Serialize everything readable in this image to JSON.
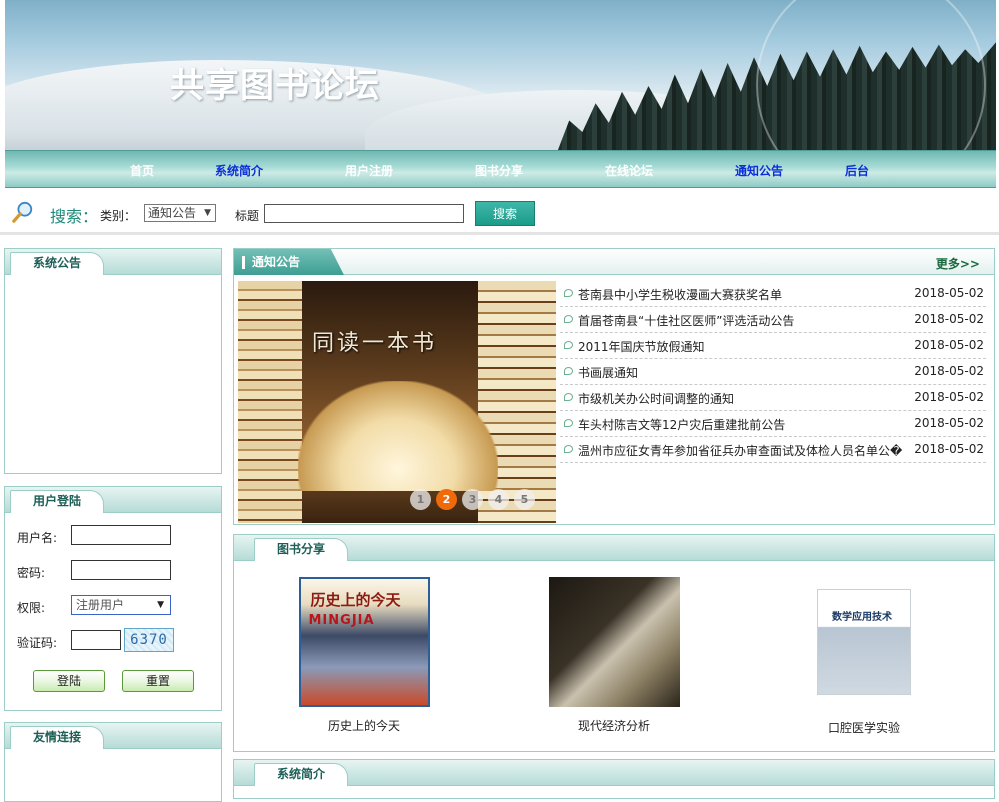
{
  "site": {
    "title": "共享图书论坛"
  },
  "nav": {
    "items": [
      {
        "label": "首页"
      },
      {
        "label": "系统简介"
      },
      {
        "label": "用户注册"
      },
      {
        "label": "图书分享"
      },
      {
        "label": "在线论坛"
      },
      {
        "label": "通知公告"
      },
      {
        "label": "后台"
      }
    ]
  },
  "search": {
    "label": "搜索：",
    "category_label": "类别：",
    "category_value": "通知公告",
    "title_label": "标题",
    "title_value": "",
    "button": "搜索"
  },
  "system_notice": {
    "title": "系统公告"
  },
  "login": {
    "title": "用户登陆",
    "username_label": "用户名:",
    "password_label": "密码:",
    "role_label": "权限:",
    "role_value": "注册用户",
    "captcha_label": "验证码:",
    "captcha_text": "6370",
    "login_button": "登陆",
    "reset_button": "重置"
  },
  "links": {
    "title": "友情连接"
  },
  "notices": {
    "title": "通知公告",
    "more": "更多>>",
    "slider_caption": "同读一本书",
    "slider_pages": [
      "1",
      "2",
      "3",
      "4",
      "5"
    ],
    "active_page": "2",
    "items": [
      {
        "title": "苍南县中小学生税收漫画大赛获奖名单",
        "date": "2018-05-02"
      },
      {
        "title": "首届苍南县“十佳社区医师”评选活动公告",
        "date": "2018-05-02"
      },
      {
        "title": "2011年国庆节放假通知",
        "date": "2018-05-02"
      },
      {
        "title": "书画展通知",
        "date": "2018-05-02"
      },
      {
        "title": "市级机关办公时间调整的通知",
        "date": "2018-05-02"
      },
      {
        "title": "车头村陈吉文等12户灾后重建批前公告",
        "date": "2018-05-02"
      },
      {
        "title": "温州市应征女青年参加省征兵办审查面试及体检人员名单公�",
        "date": "2018-05-02"
      }
    ]
  },
  "books": {
    "title": "图书分享",
    "items": [
      {
        "name": "历史上的今天",
        "cover_title": "历史上的今天",
        "cover_sub": "MINGJIA"
      },
      {
        "name": "现代经济分析"
      },
      {
        "name": "口腔医学实验",
        "cover_title": "数学应用技术"
      }
    ]
  },
  "intro": {
    "title": "系统简介"
  }
}
